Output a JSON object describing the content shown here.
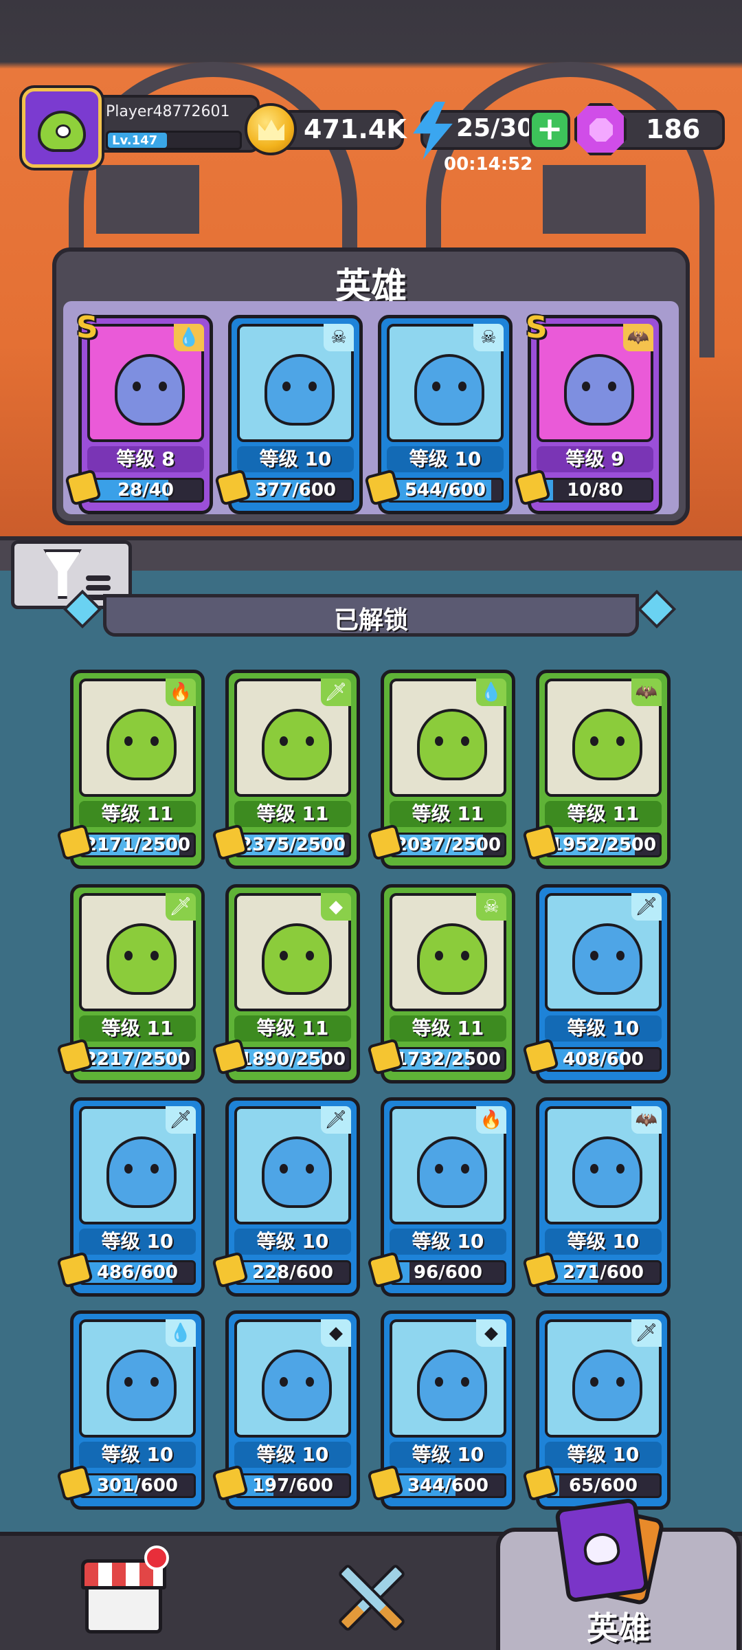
{
  "player": {
    "name": "Player48772601",
    "level_label": "Lv.147",
    "xp_fraction": 0.45
  },
  "currency": {
    "gold": "471.4K",
    "energy": "25/30",
    "energy_timer": "00:14:52",
    "gems": "186"
  },
  "team": {
    "title": "英雄",
    "heroes": [
      {
        "rarity": "purple",
        "rank": "S",
        "element": "water-drop-icon",
        "level": "等级 8",
        "shards": "28/40",
        "fill": 0.7
      },
      {
        "rarity": "blue",
        "rank": "",
        "element": "skull-icon",
        "level": "等级 10",
        "shards": "377/600",
        "fill": 0.63
      },
      {
        "rarity": "blue",
        "rank": "",
        "element": "skull-icon",
        "level": "等级 10",
        "shards": "544/600",
        "fill": 0.91
      },
      {
        "rarity": "purple",
        "rank": "S",
        "element": "bat-icon",
        "level": "等级 9",
        "shards": "10/80",
        "fill": 0.13
      }
    ]
  },
  "section": {
    "title": "已解锁"
  },
  "unlocked_heroes": [
    {
      "rarity": "green",
      "element": "fire-icon",
      "level": "等级 11",
      "shards": "2171/2500",
      "fill": 0.87
    },
    {
      "rarity": "green",
      "element": "sword-icon",
      "level": "等级 11",
      "shards": "2375/2500",
      "fill": 0.95
    },
    {
      "rarity": "green",
      "element": "water-drop-icon",
      "level": "等级 11",
      "shards": "2037/2500",
      "fill": 0.81
    },
    {
      "rarity": "green",
      "element": "bat-icon",
      "level": "等级 11",
      "shards": "1952/2500",
      "fill": 0.78
    },
    {
      "rarity": "green",
      "element": "sword-icon",
      "level": "等级 11",
      "shards": "2217/2500",
      "fill": 0.89
    },
    {
      "rarity": "green",
      "element": "rock-icon",
      "level": "等级 11",
      "shards": "1890/2500",
      "fill": 0.76
    },
    {
      "rarity": "green",
      "element": "skull-icon",
      "level": "等级 11",
      "shards": "1732/2500",
      "fill": 0.69
    },
    {
      "rarity": "blue",
      "element": "sword-icon",
      "level": "等级 10",
      "shards": "408/600",
      "fill": 0.68
    },
    {
      "rarity": "blue",
      "element": "sword-icon",
      "level": "等级 10",
      "shards": "486/600",
      "fill": 0.81
    },
    {
      "rarity": "blue",
      "element": "sword-icon",
      "level": "等级 10",
      "shards": "228/600",
      "fill": 0.38
    },
    {
      "rarity": "blue",
      "element": "fire-icon",
      "level": "等级 10",
      "shards": "96/600",
      "fill": 0.16
    },
    {
      "rarity": "blue",
      "element": "bat-icon",
      "level": "等级 10",
      "shards": "271/600",
      "fill": 0.45
    },
    {
      "rarity": "blue",
      "element": "water-drop-icon",
      "level": "等级 10",
      "shards": "301/600",
      "fill": 0.5
    },
    {
      "rarity": "blue",
      "element": "rock-icon",
      "level": "等级 10",
      "shards": "197/600",
      "fill": 0.33
    },
    {
      "rarity": "blue",
      "element": "rock-icon",
      "level": "等级 10",
      "shards": "344/600",
      "fill": 0.57
    },
    {
      "rarity": "blue",
      "element": "sword-icon",
      "level": "等级 10",
      "shards": "65/600",
      "fill": 0.11
    }
  ],
  "nav": {
    "heroes_label": "英雄"
  },
  "element_glyphs": {
    "fire-icon": "🔥",
    "sword-icon": "🗡",
    "water-drop-icon": "💧",
    "bat-icon": "🦇",
    "rock-icon": "◆",
    "skull-icon": "☠"
  }
}
